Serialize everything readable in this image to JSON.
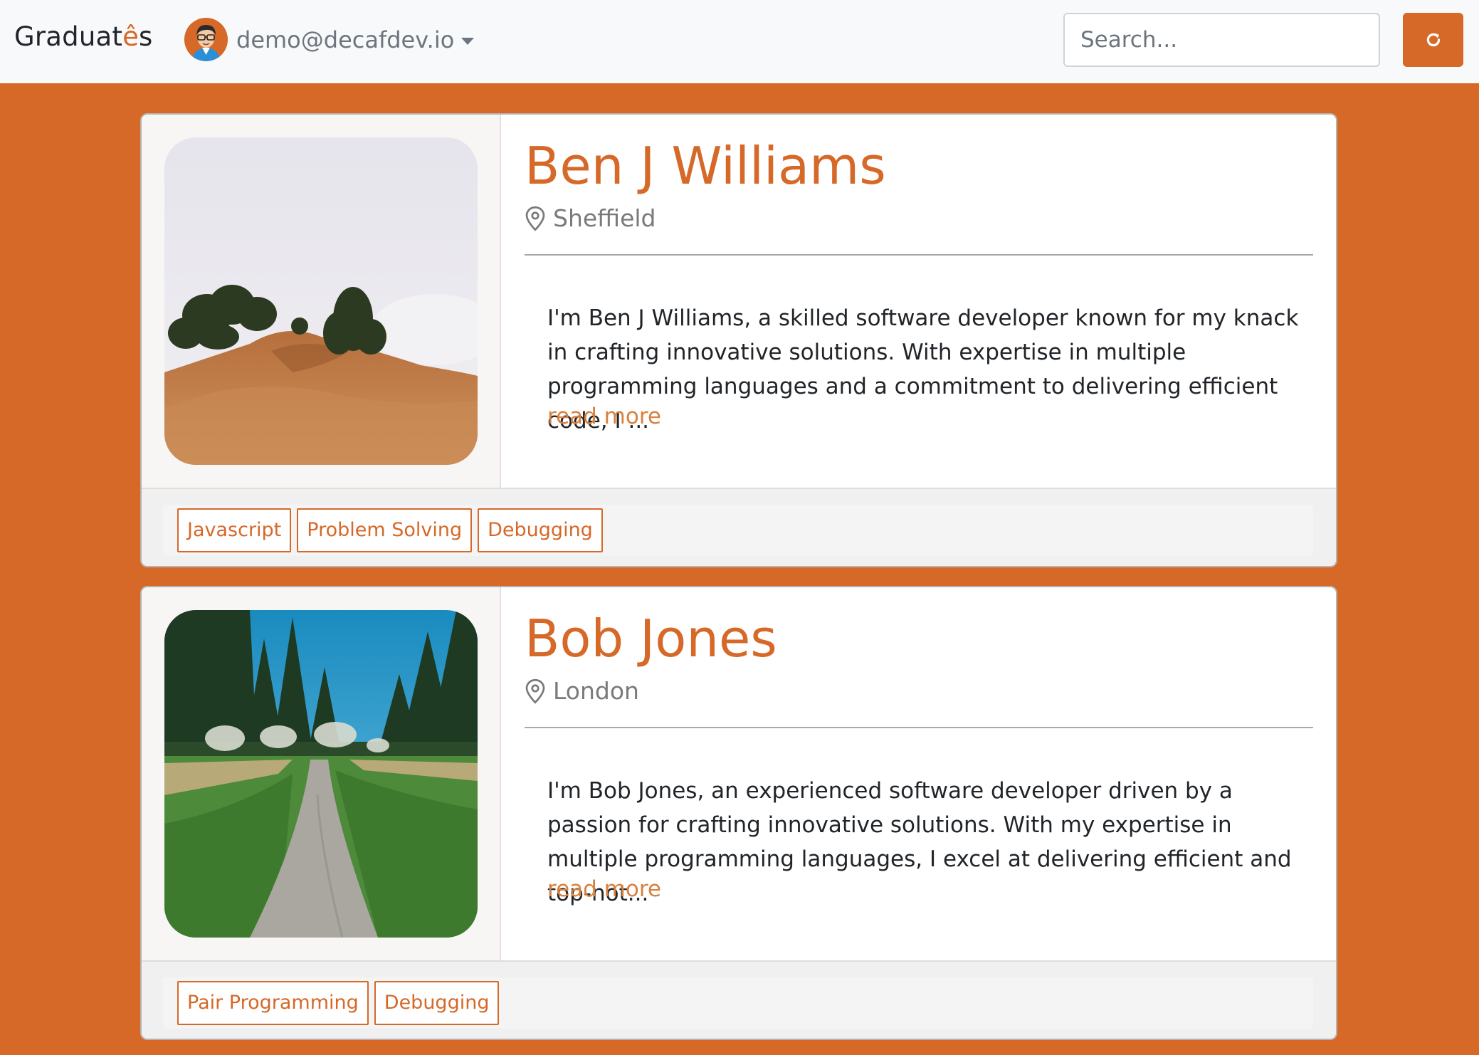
{
  "brand": {
    "name_start": "Graduat",
    "name_accent": "ê",
    "name_end": "s"
  },
  "user": {
    "email": "demo@decafdev.io",
    "avatar_icon": "user-avatar-icon"
  },
  "search": {
    "placeholder": "Search..."
  },
  "refresh": {
    "icon": "refresh-icon"
  },
  "colors": {
    "accent": "#d66828",
    "background": "#d66828",
    "link": "#d9813e"
  },
  "graduates": [
    {
      "name": "Ben J Williams",
      "location": "Sheffield",
      "bio": "I'm Ben J Williams, a skilled software developer known for my knack in crafting innovative solutions. With expertise in multiple programming languages and a commitment to delivering efficient code, I ...",
      "read_more": "read more",
      "tags": [
        "Javascript",
        "Problem Solving",
        "Debugging"
      ],
      "image_desc": "foggy-hill-photo"
    },
    {
      "name": "Bob Jones",
      "location": "London",
      "bio": "I'm Bob Jones, an experienced software developer driven by a passion for crafting innovative solutions. With my expertise in multiple programming languages, I excel at delivering efficient and top-not...",
      "read_more": "read more",
      "tags": [
        "Pair Programming",
        "Debugging"
      ],
      "image_desc": "forest-path-photo"
    }
  ]
}
